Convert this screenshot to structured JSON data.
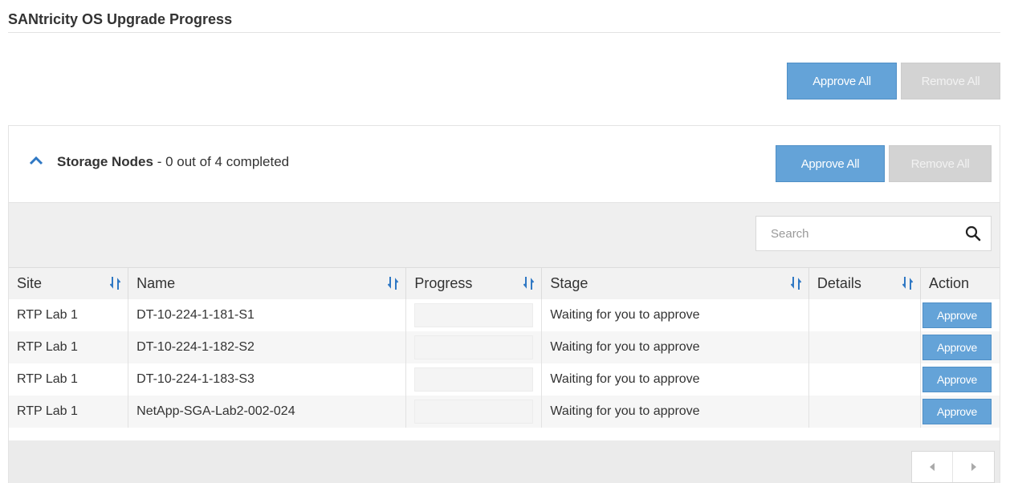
{
  "page": {
    "title": "SANtricity OS Upgrade Progress"
  },
  "top_actions": {
    "approve_all": "Approve All",
    "remove_all": "Remove All"
  },
  "panel": {
    "group_name": "Storage Nodes",
    "status": " - 0 out of 4 completed",
    "approve_all": "Approve All",
    "remove_all": "Remove All"
  },
  "search": {
    "placeholder": "Search",
    "value": ""
  },
  "table": {
    "columns": [
      "Site",
      "Name",
      "Progress",
      "Stage",
      "Details",
      "Action"
    ],
    "rows": [
      {
        "site": "RTP Lab 1",
        "name": "DT-10-224-1-181-S1",
        "progress": 0,
        "stage": "Waiting for you to approve",
        "details": "",
        "action": "Approve"
      },
      {
        "site": "RTP Lab 1",
        "name": "DT-10-224-1-182-S2",
        "progress": 0,
        "stage": "Waiting for you to approve",
        "details": "",
        "action": "Approve"
      },
      {
        "site": "RTP Lab 1",
        "name": "DT-10-224-1-183-S3",
        "progress": 0,
        "stage": "Waiting for you to approve",
        "details": "",
        "action": "Approve"
      },
      {
        "site": "RTP Lab 1",
        "name": "NetApp-SGA-Lab2-002-024",
        "progress": 0,
        "stage": "Waiting for you to approve",
        "details": "",
        "action": "Approve"
      }
    ]
  },
  "icons": {
    "collapse": "chevron-up-icon",
    "search": "search-icon",
    "sort": "sort-icon",
    "prev": "chevron-left-icon",
    "next": "chevron-right-icon"
  },
  "colors": {
    "primary": "#64a3d8",
    "disabled": "#d3d3d3",
    "chevron": "#2f78c4"
  }
}
